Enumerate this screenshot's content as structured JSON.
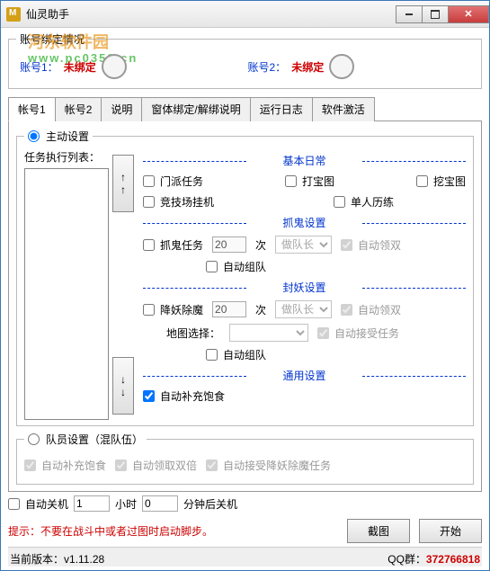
{
  "window": {
    "title": "仙灵助手"
  },
  "watermark": {
    "line1": "河东软件园",
    "line2": "www.pc0359.cn"
  },
  "binding": {
    "legend": "账号绑定情况",
    "acc1_label": "账号1：",
    "acc1_value": "未绑定",
    "acc2_label": "账号2：",
    "acc2_value": "未绑定"
  },
  "tabs": [
    "帐号1",
    "帐号2",
    "说明",
    "窗体绑定/解绑说明",
    "运行日志",
    "软件激活"
  ],
  "active_settings": {
    "legend": "主动设置",
    "listlabel": "任务执行列表：",
    "sect_basic": "基本日常",
    "cb_menpai": "门派任务",
    "cb_dabaotu": "打宝图",
    "cb_wabaotu": "挖宝图",
    "cb_jingji": "竞技场挂机",
    "cb_danren": "单人历练",
    "sect_ghost": "抓鬼设置",
    "cb_ghost": "抓鬼任务",
    "ghost_count": 20,
    "times": "次",
    "role_opt": "做队长",
    "cb_autoleader": "自动领双",
    "cb_autoteam": "自动组队",
    "sect_yao": "封妖设置",
    "cb_yao": "降妖除魔",
    "yao_count": 20,
    "map_label": "地图选择：",
    "cb_autoaccept": "自动接受任务",
    "sect_common": "通用设置",
    "cb_food": "自动补充饱食"
  },
  "team_settings": {
    "legend": "队员设置（混队伍）",
    "cb_food": "自动补充饱食",
    "cb_double": "自动领取双倍",
    "cb_accept_yao": "自动接受降妖除魔任务"
  },
  "shutdown": {
    "cb": "自动关机",
    "hours": 1,
    "hours_label": "小时",
    "mins": 0,
    "mins_label": "分钟后关机"
  },
  "warn": "提示：不要在战斗中或者过图时启动脚步。",
  "buttons": {
    "screenshot": "截图",
    "start": "开始"
  },
  "footer": {
    "version_label": "当前版本：",
    "version": "v1.11.28",
    "qq_label": "QQ群：",
    "qq": "372766818"
  }
}
